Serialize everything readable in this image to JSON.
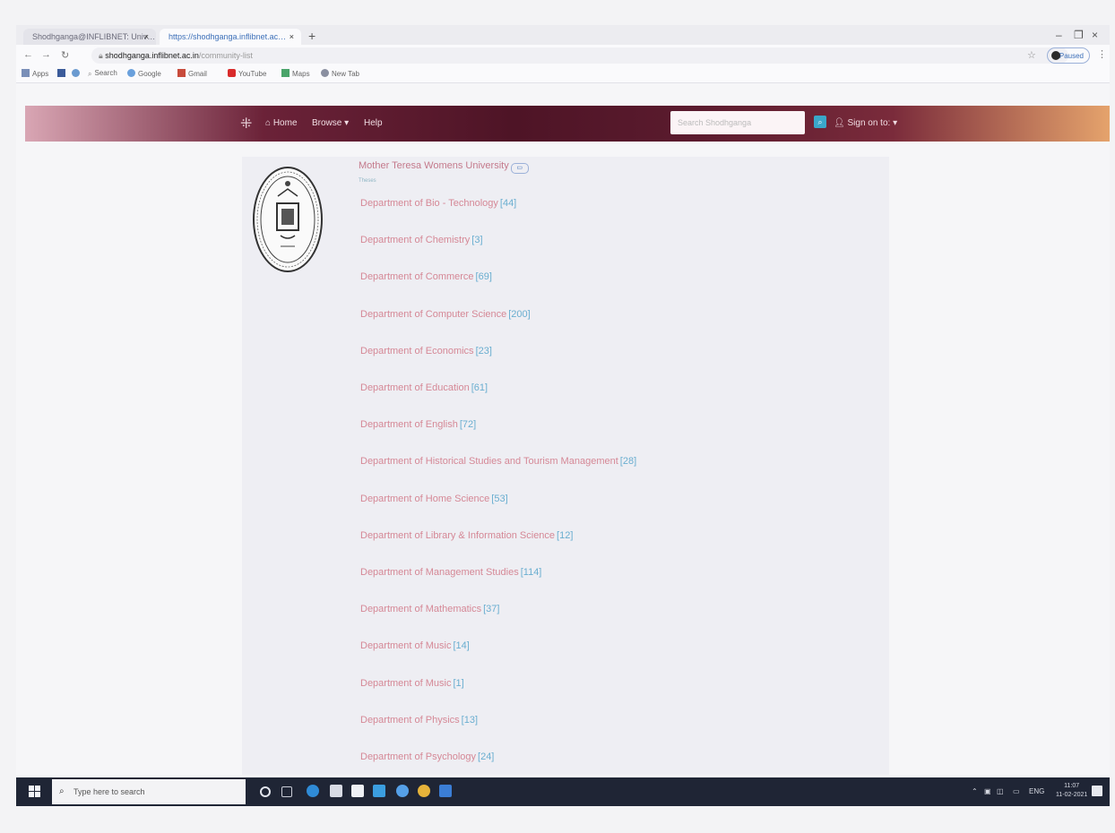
{
  "browser": {
    "tabs": [
      {
        "label": "Shodhganga@INFLIBNET: Univ…"
      },
      {
        "label": "https://shodhganga.inflibnet.ac…"
      }
    ],
    "new_tab": "+",
    "address": {
      "host": "shodhganga.inflibnet.ac.in",
      "path": "/community-list"
    },
    "profile_label": "Paused",
    "bookmarks": [
      {
        "label": "Apps"
      },
      {
        "label": "Search"
      },
      {
        "label": "Google"
      },
      {
        "label": "Gmail"
      },
      {
        "label": "YouTube"
      },
      {
        "label": "Maps"
      },
      {
        "label": "New Tab"
      }
    ]
  },
  "site": {
    "nav": {
      "home": "Home",
      "browse": "Browse ▾",
      "help": "Help"
    },
    "search_placeholder": "Search Shodhganga",
    "signin": "Sign on to: ▾"
  },
  "content": {
    "university": "Mother Teresa Womens University",
    "subtitle": "Theses",
    "departments": [
      {
        "name": "Department of Bio - Technology",
        "count": "[44]"
      },
      {
        "name": "Department of Chemistry",
        "count": "[3]"
      },
      {
        "name": "Department of Commerce",
        "count": "[69]"
      },
      {
        "name": "Department of Computer Science",
        "count": "[200]"
      },
      {
        "name": "Department of Economics",
        "count": "[23]"
      },
      {
        "name": "Department of Education",
        "count": "[61]"
      },
      {
        "name": "Department of English",
        "count": "[72]"
      },
      {
        "name": "Department of Historical Studies and Tourism Management",
        "count": "[28]"
      },
      {
        "name": "Department of Home Science",
        "count": "[53]"
      },
      {
        "name": "Department of Library & Information Science",
        "count": "[12]"
      },
      {
        "name": "Department of Management Studies",
        "count": "[114]"
      },
      {
        "name": "Department of Mathematics",
        "count": "[37]"
      },
      {
        "name": "Department of Music",
        "count": "[14]"
      },
      {
        "name": "Department of Music",
        "count": "[1]"
      },
      {
        "name": "Department of Physics",
        "count": "[13]"
      },
      {
        "name": "Department of Psychology",
        "count": "[24]"
      }
    ]
  },
  "taskbar": {
    "search_placeholder": "Type here to search",
    "tray_lang": "ENG",
    "time": "11:07",
    "date": "11-02-2021"
  },
  "colors": {
    "header_dark": "#4e1426",
    "link": "#d58896",
    "count": "#6aaed0",
    "taskbar": "#1f2535"
  }
}
